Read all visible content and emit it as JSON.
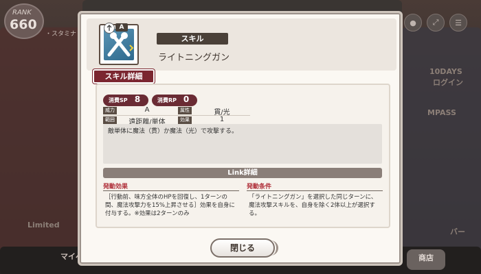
{
  "background": {
    "rank_label": "RANK",
    "rank_value": "660",
    "stamina_label": "・スタミナ /",
    "left_texts": [
      "Limited"
    ],
    "right_texts": [
      "10DAYS",
      "ログイン",
      "MPASS",
      "バー"
    ],
    "shop_label": "商店",
    "mypage_label": "マイペ"
  },
  "dialog": {
    "skill_tag": "スキル",
    "skill_name": "ライトニングガン",
    "rank_letter": "A",
    "tab_label": "スキル詳細",
    "sp_label": "消費SP",
    "sp_value": "8",
    "rp_label": "消費RP",
    "rp_value": "0",
    "attrs": {
      "power_label": "威力",
      "power_value": "A",
      "element_label": "属性",
      "element_value": "貫/光",
      "range_label": "範囲",
      "range_value": "遠距離/単体",
      "times_label": "効果回数",
      "times_value": "1"
    },
    "description": "敵単体に魔法（貫）か魔法（光）で攻撃する。",
    "link_title": "Link詳細",
    "effect_title": "発動効果",
    "effect_text": "［行動前、味方全体のHPを回復し、1ターンの間、魔法攻撃力を15%上昇させる］効果を自身に付与する。※効果は2ターンのみ",
    "condition_title": "発動条件",
    "condition_text": "「ライトニングガン」を選択した同じターンに、魔法攻撃スキルを、自身を除く2体以上が選択する。",
    "close_label": "閉じる"
  }
}
